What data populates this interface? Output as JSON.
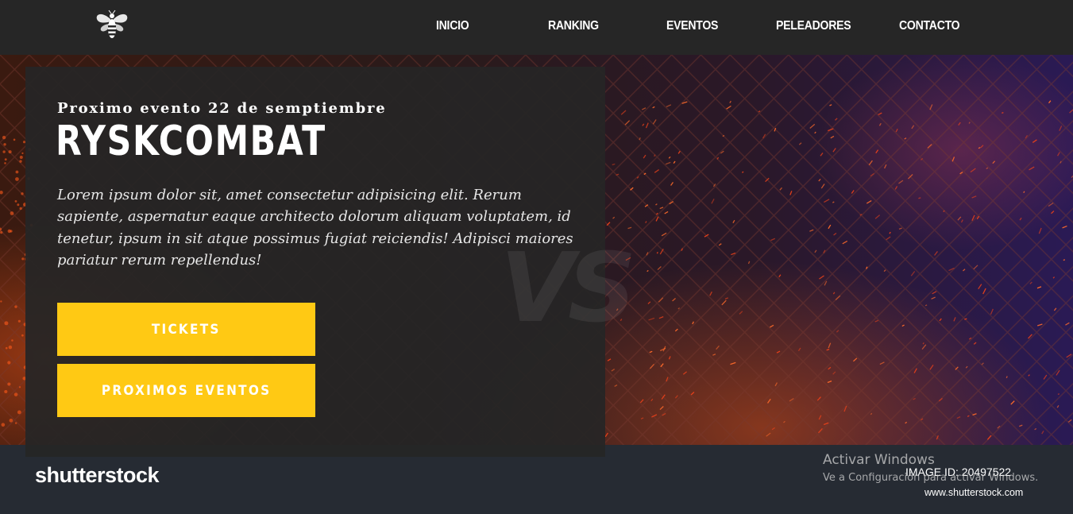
{
  "nav": {
    "logo_icon": "bee-icon",
    "items": [
      "INICIO",
      "RANKING",
      "EVENTOS",
      "PELEADORES",
      "CONTACTO"
    ]
  },
  "hero": {
    "eyebrow": "Proximo evento 22 de semptiembre",
    "title": "RYSKCOMBAT",
    "description": "Lorem ipsum dolor sit, amet consectetur adipisicing elit. Rerum sapiente, aspernatur eaque architecto dolorum aliquam voluptatem, id tenetur, ipsum in sit atque possimus fugiat reiciendis! Adipisci maiores pariatur rerum repellendus!",
    "buttons": {
      "tickets": "TICKETS",
      "upcoming": "PROXIMOS EVENTOS"
    },
    "background_mark": "VS"
  },
  "watermark": {
    "brand": "shutterstock",
    "image_id": "IMAGE ID: 20497522",
    "site": "www.shutterstock.com"
  },
  "windows_activation": {
    "title": "Activar Windows",
    "subtitle": "Ve a Configuración para activar Windows."
  },
  "colors": {
    "header_bg": "#262626",
    "card_bg": "#262626",
    "accent": "#ffc914",
    "footer_strip": "#262b33"
  }
}
